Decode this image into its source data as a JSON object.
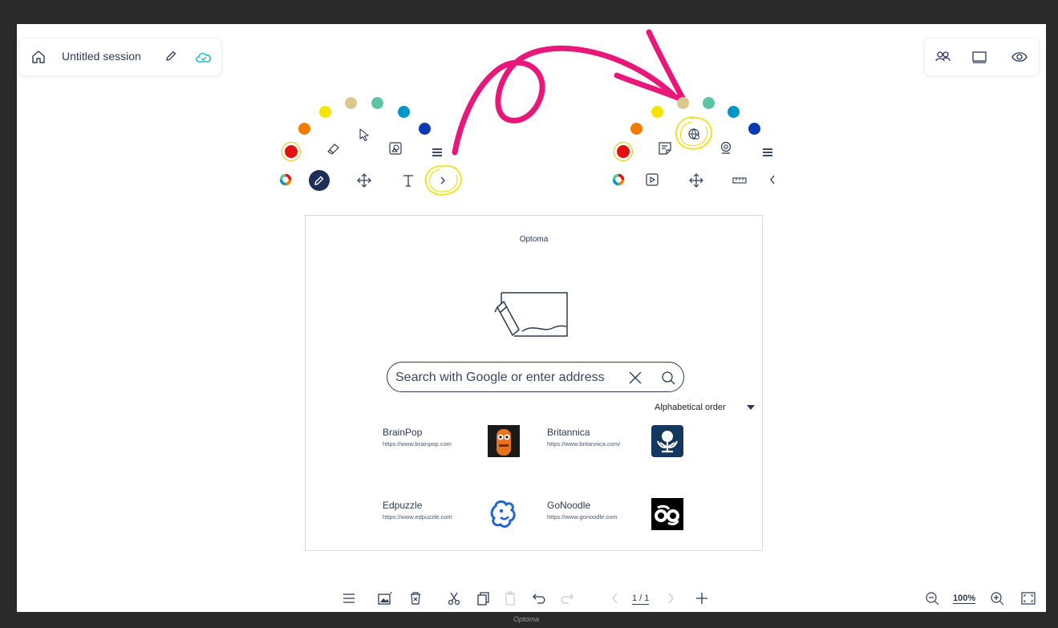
{
  "session": {
    "title": "Untitled session"
  },
  "browser": {
    "title": "Optoma",
    "search_placeholder": "Search with Google or enter address",
    "sort_label": "Alphabetical order",
    "sites": [
      {
        "name": "BrainPop",
        "url": "https://www.brainpop.com"
      },
      {
        "name": "Britannica",
        "url": "https://www.britannica.com/"
      },
      {
        "name": "Edpuzzle",
        "url": "https://www.edpuzzle.com"
      },
      {
        "name": "GoNoodle",
        "url": "https://www.gonoodle.com"
      }
    ]
  },
  "bottom": {
    "page": "1 / 1",
    "zoom": "100%"
  },
  "device": {
    "brand": "Optoma"
  },
  "colors": {
    "accent": "#2b3a55",
    "arrow": "#e8177a",
    "highlight": "#f2e20c",
    "palette": [
      "#e31010",
      "#f57c00",
      "#f5e400",
      "#d9c98f",
      "#5cc4a3",
      "#0097c7",
      "#0a3bb5"
    ]
  },
  "icons": {
    "left_toolbar": [
      "color-wheel-icon",
      "pen-icon",
      "move-icon",
      "text-icon",
      "expand-icon",
      "eraser-icon",
      "select-icon",
      "shapes-icon",
      "menu-icon"
    ],
    "right_toolbar": [
      "color-wheel-icon",
      "media-icon",
      "move-icon",
      "ruler-icon",
      "collapse-icon",
      "sticky-note-icon",
      "browser-icon",
      "camera-icon",
      "menu-icon"
    ]
  }
}
